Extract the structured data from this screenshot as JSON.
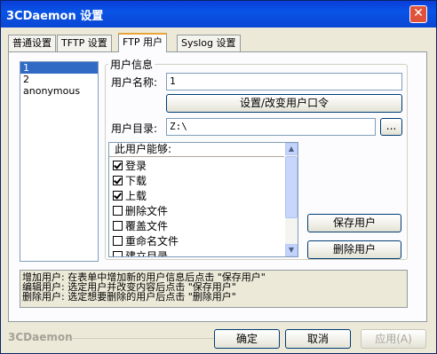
{
  "window": {
    "title": "3CDaemon 设置",
    "close_glyph": "✕"
  },
  "tabs": [
    {
      "label": "普通设置"
    },
    {
      "label": "TFTP 设置"
    },
    {
      "label": "FTP 用户"
    },
    {
      "label": "Syslog 设置"
    }
  ],
  "user_list": [
    "1",
    "2",
    "anonymous"
  ],
  "user_info": {
    "group_title": "用户信息",
    "username_label": "用户名称:",
    "username_value": "1",
    "set_password_button": "设置/改变用户口令",
    "home_dir_label": "用户目录:",
    "home_dir_value": "Z:\\",
    "browse_button": "...",
    "permissions_header": "此用户能够:",
    "permissions": [
      {
        "label": "登录",
        "checked": true
      },
      {
        "label": "下载",
        "checked": true
      },
      {
        "label": "上载",
        "checked": true
      },
      {
        "label": "删除文件",
        "checked": false
      },
      {
        "label": "覆盖文件",
        "checked": false
      },
      {
        "label": "重命名文件",
        "checked": false
      },
      {
        "label": "建立目录",
        "checked": false
      }
    ],
    "save_user_button": "保存用户",
    "delete_user_button": "删除用户"
  },
  "help_text": [
    "增加用户: 在表单中增加新的用户信息后点击 \"保存用户\"",
    "编辑用户: 选定用户并改变内容后点击 \"保存用户\"",
    "删除用户: 选定想要删除的用户后点击 \"删除用户\""
  ],
  "footer": {
    "brand": "3CDaemon",
    "ok_button": "确定",
    "cancel_button": "取消",
    "apply_button": "应用(A)"
  },
  "colors": {
    "titlebar": "#0a46d4",
    "selection": "#316ac5",
    "tab_highlight": "#e9a53a",
    "close_button": "#e0533a"
  }
}
